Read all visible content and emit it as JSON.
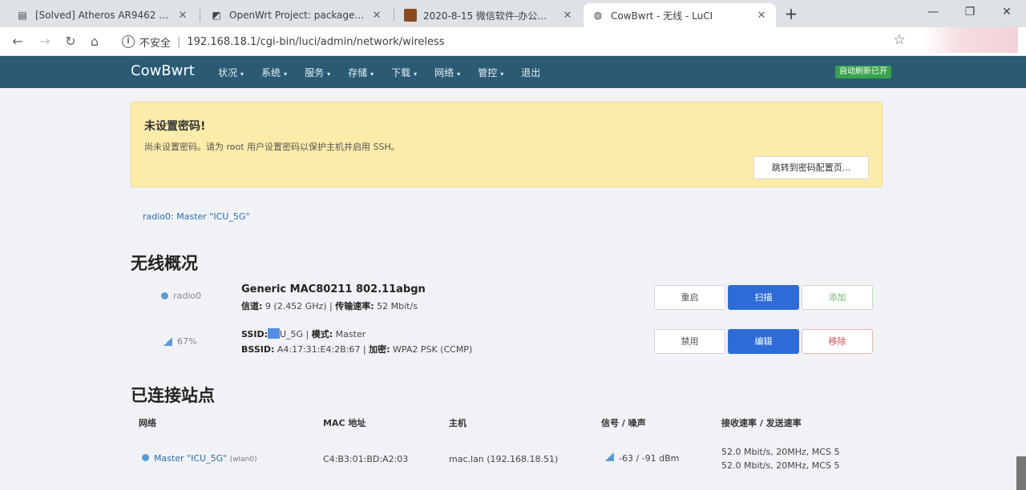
{
  "browser": {
    "tabs": [
      {
        "label": "[Solved] Atheros AR9462 on ..."
      },
      {
        "label": "OpenWrt Project: packages:..."
      },
      {
        "label": "2020-8-15 微信软件-办公图片..."
      },
      {
        "label": "CowBwrt - 无线 - LuCI"
      }
    ],
    "new_tab": "+",
    "window": {
      "minimize": "—",
      "restore": "❐",
      "close": "✕"
    },
    "nav": {
      "back": "←",
      "forward": "→",
      "reload": "↻",
      "home": "⌂"
    },
    "security_icon": "i",
    "security_text": "不安全",
    "url": "192.168.18.1/cgi-bin/luci/admin/network/wireless",
    "bookmark": "☆"
  },
  "header": {
    "brand": "CowBwrt",
    "menu": [
      "状况",
      "系统",
      "服务",
      "存储",
      "下载",
      "网络",
      "管控",
      "退出"
    ],
    "autorefresh": "自动刷新已开"
  },
  "alert": {
    "title": "未设置密码!",
    "text": "尚未设置密码。请为 root 用户设置密码以保护主机并启用 SSH。",
    "button": "跳转到密码配置页..."
  },
  "radio_tab": "radio0: Master \"ICU_5G\"",
  "overview": {
    "heading": "无线概况",
    "device": {
      "name": "radio0",
      "title": "Generic MAC80211 802.11abgn",
      "channel_label": "信道:",
      "channel_value": "9 (2.452 GHz)",
      "bitrate_label": "传输速率:",
      "bitrate_value": "52 Mbit/s",
      "buttons": [
        "重启",
        "扫描",
        "添加"
      ]
    },
    "network": {
      "signal": "67%",
      "ssid_label": "SSID:",
      "ssid_value": "U_5G",
      "mode_label": "模式:",
      "mode_value": "Master",
      "bssid_label": "BSSID:",
      "bssid_value": "A4:17:31:E4:2B:67",
      "enc_label": "加密:",
      "enc_value": "WPA2 PSK (CCMP)",
      "buttons": [
        "禁用",
        "编辑",
        "移除"
      ]
    }
  },
  "stations": {
    "heading": "已连接站点",
    "columns": [
      "网络",
      "MAC 地址",
      "主机",
      "信号 / 噪声",
      "接收速率 / 发送速率"
    ],
    "rows": [
      {
        "network": "Master \"ICU_5G\"",
        "iface": "(wlan0)",
        "mac": "C4:B3:01:BD:A2:03",
        "host": "mac.lan (192.168.18.51)",
        "signal": "-63 / -91 dBm",
        "rx": "52.0 Mbit/s, 20MHz, MCS 5",
        "tx": "52.0 Mbit/s, 20MHz, MCS 5"
      }
    ]
  },
  "colors": {
    "nav": "#2a5a74",
    "primary": "#2d6cd6",
    "alert": "#fbeca9"
  }
}
